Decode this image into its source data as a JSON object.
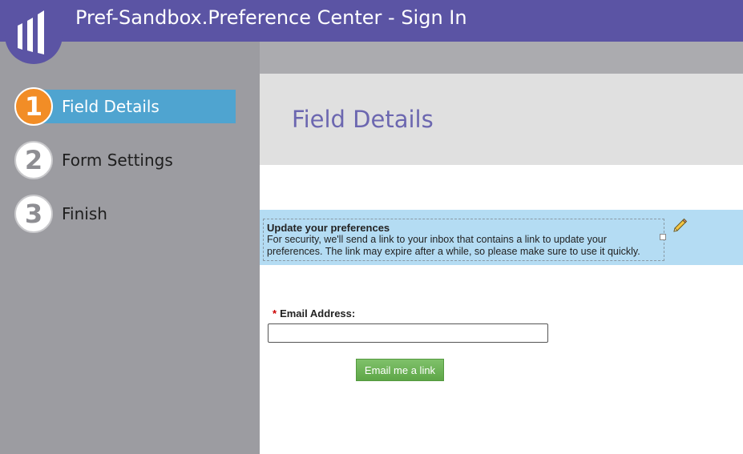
{
  "header": {
    "title": "Pref-Sandbox.Preference Center - Sign In"
  },
  "logo": {
    "icon": "marketo-logo-icon"
  },
  "steps": [
    {
      "number": "1",
      "label": "Field Details",
      "active": true
    },
    {
      "number": "2",
      "label": "Form Settings",
      "active": false
    },
    {
      "number": "3",
      "label": "Finish",
      "active": false
    }
  ],
  "main": {
    "title": "Field Details",
    "richtext": {
      "heading": "Update your preferences",
      "body": "For security, we'll send a link to your inbox that contains a link to update your preferences. The link may expire after a while, so please make sure to use it quickly."
    },
    "email": {
      "required_mark": "*",
      "label": "Email Address:",
      "value": ""
    },
    "submit_label": "Email me a link"
  },
  "colors": {
    "header": "#5b54a4",
    "sidebar": "#9c9ca1",
    "active_step": "#4fa4d0",
    "active_circle": "#f28d26",
    "title": "#6c67b0",
    "richtext_band": "#b4dcf3",
    "button": "#5ea648"
  }
}
